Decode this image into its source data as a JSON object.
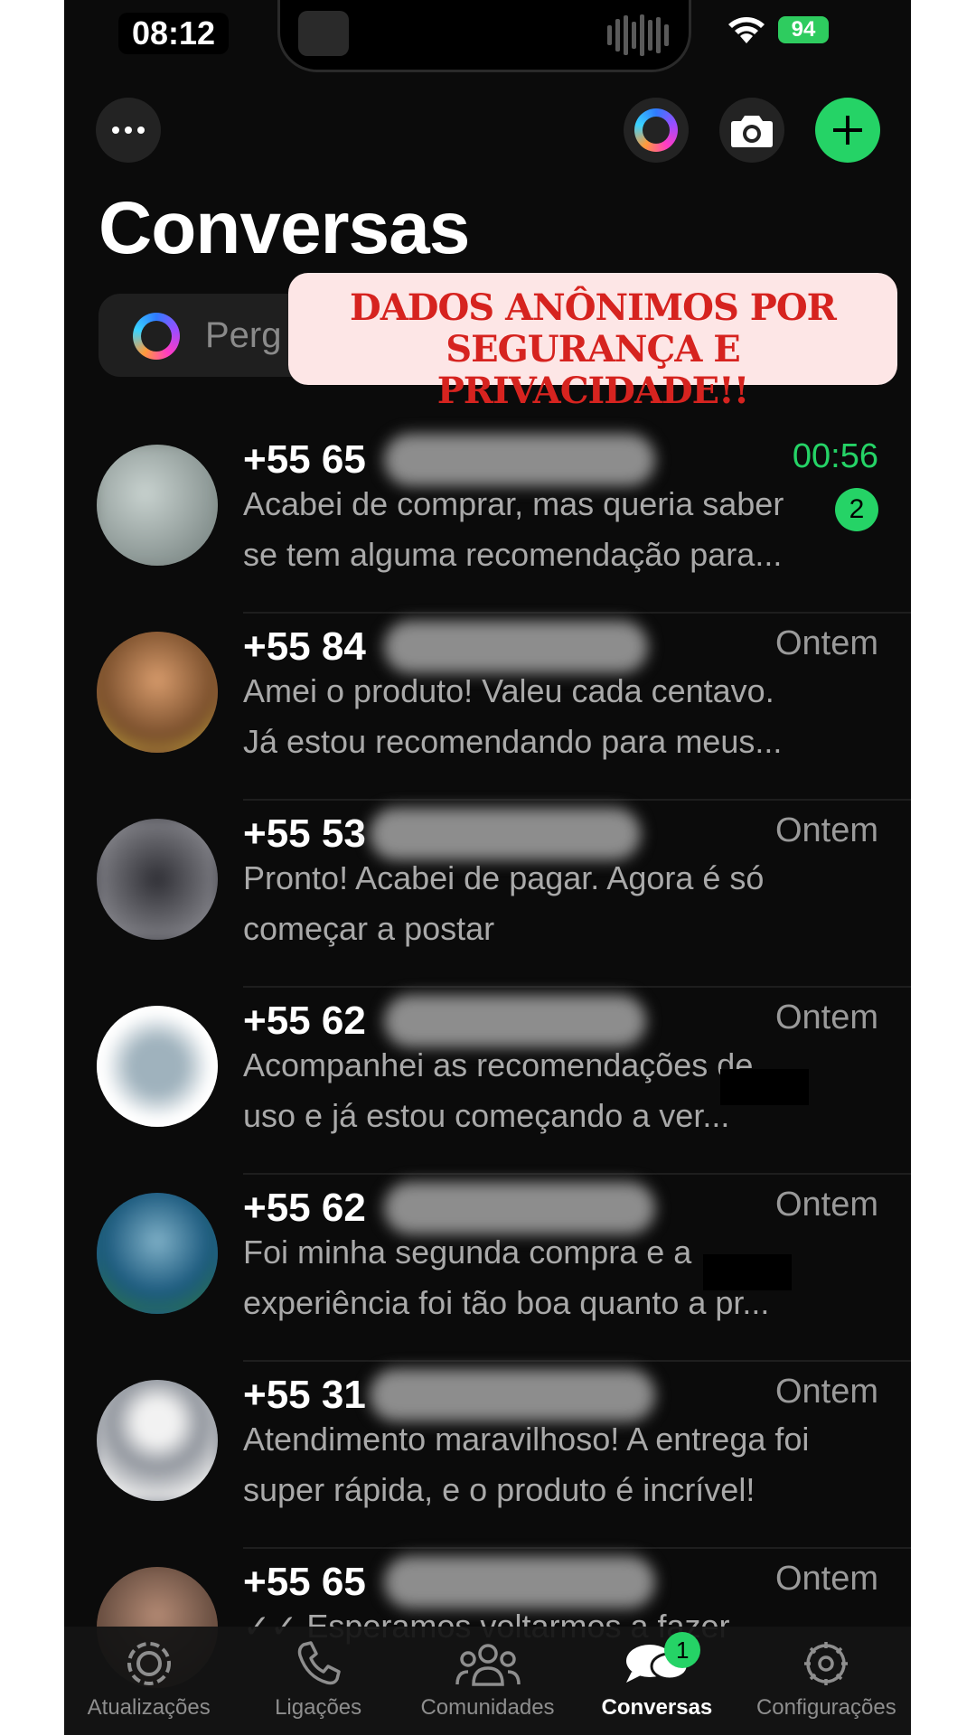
{
  "status_bar": {
    "time": "08:12",
    "battery": "94"
  },
  "header": {
    "title": "Conversas"
  },
  "search": {
    "placeholder": "Perg"
  },
  "overlay": {
    "line1": "DADOS ANÔNIMOS POR",
    "line2": "SEGURANÇA E PRIVACIDADE!!"
  },
  "chats": [
    {
      "name": "+55 65",
      "time": "00:56",
      "unread": "2",
      "preview": "Acabei de comprar, mas queria saber se tem alguma recomendação para...",
      "avatar_color": "#9aa6a0"
    },
    {
      "name": "+55 84",
      "time": "Ontem",
      "preview": "Amei o produto! Valeu cada centavo. Já estou recomendando para meus...",
      "avatar_color": "#a56b3c"
    },
    {
      "name": "+55 53",
      "time": "Ontem",
      "preview": "Pronto! Acabei de pagar. Agora é só começar a postar",
      "avatar_color": "#5a5a62"
    },
    {
      "name": "+55 62",
      "time": "Ontem",
      "preview": "Acompanhei as recomendações de uso e já estou começando a ver...",
      "avatar_color": "#b7c2c8"
    },
    {
      "name": "+55 62",
      "time": "Ontem",
      "preview": "Foi minha segunda compra e a experiência foi tão boa quanto a pr...",
      "avatar_color": "#2f6a90"
    },
    {
      "name": "+55 31",
      "time": "Ontem",
      "preview": "Atendimento maravilhoso! A entrega foi super rápida, e o produto é incrível!",
      "avatar_color": "#9ea3aa"
    },
    {
      "name": "+55 65",
      "time": "Ontem",
      "preview": "Esperamos voltarmos a fazer",
      "avatar_color": "#7a5a4a"
    }
  ],
  "tabs": [
    {
      "label": "Atualizações"
    },
    {
      "label": "Ligações"
    },
    {
      "label": "Comunidades"
    },
    {
      "label": "Conversas",
      "badge": "1"
    },
    {
      "label": "Configurações"
    }
  ],
  "colors": {
    "accent": "#25d366",
    "background": "#0b0b0b",
    "banner_text": "#d6231f"
  }
}
